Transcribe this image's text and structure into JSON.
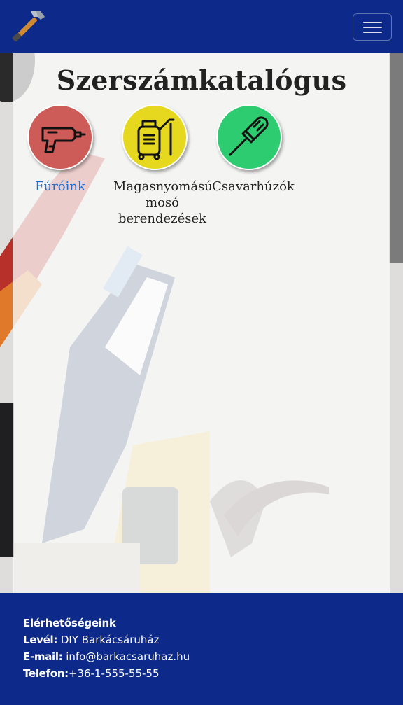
{
  "navbar": {
    "logo": "hammer-icon",
    "toggler": "hamburger-menu-icon"
  },
  "main": {
    "title": "Szerszámkatalógus",
    "categories": [
      {
        "label": "Fúróink",
        "icon": "drill-icon",
        "color": "#cd5b57",
        "link": true
      },
      {
        "label_lines": [
          "Magasnyomású",
          "mosó",
          "berendezések"
        ],
        "icon": "pressure-washer-icon",
        "color": "#e6d81e"
      },
      {
        "label": "Csavarhúzók",
        "icon": "screwdriver-icon",
        "color": "#2ecc71"
      }
    ]
  },
  "footer": {
    "heading": "Elérhetőségeink",
    "letter_label": "Levél:",
    "letter_value": "DIY Barkácsáruház",
    "email_label": "E-mail:",
    "email_value": "info@barkacsaruhaz.hu",
    "phone_label": "Telefon:",
    "phone_value": "+36-1-555-55-55"
  },
  "colors": {
    "navbar": "#0d2a8a",
    "link": "#1f6fd1"
  }
}
